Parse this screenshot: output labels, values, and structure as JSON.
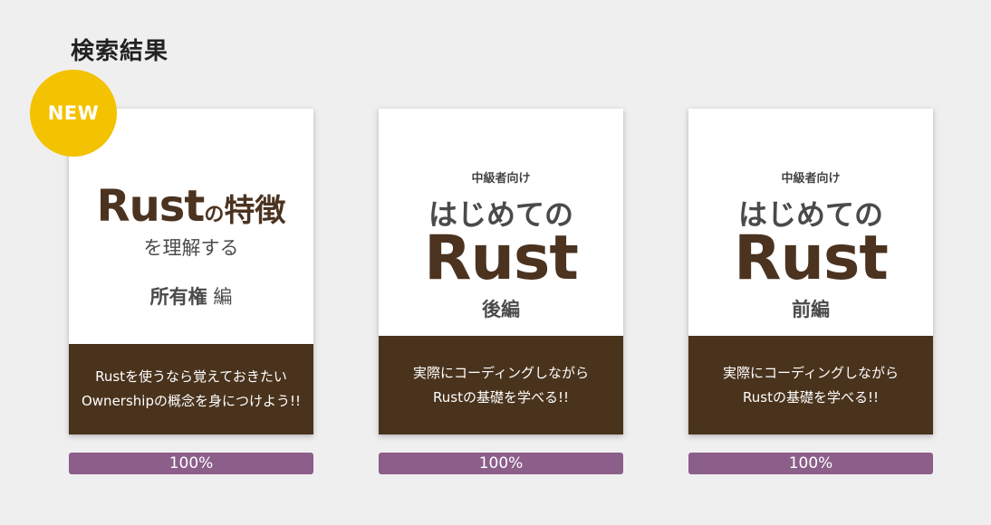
{
  "page": {
    "title": "検索結果"
  },
  "badge": {
    "new_label": "NEW"
  },
  "books": [
    {
      "cover": {
        "title_rust": "Rust",
        "title_no": "の",
        "title_toku": "特徴",
        "subtitle": "を理解する",
        "edition_main": "所有権",
        "edition_suffix": " 編"
      },
      "blurb_line1": "Rustを使うなら覚えておきたい",
      "blurb_line2": "Ownershipの概念を身につけよう!!",
      "progress": "100%"
    },
    {
      "cover": {
        "level": "中級者向け",
        "title_line1": "はじめての",
        "title_line2": "Rust",
        "edition": "後編"
      },
      "blurb_line1": "実際にコーディングしながら",
      "blurb_line2": "Rustの基礎を学べる!!",
      "progress": "100%"
    },
    {
      "cover": {
        "level": "中級者向け",
        "title_line1": "はじめての",
        "title_line2": "Rust",
        "edition": "前編"
      },
      "blurb_line1": "実際にコーディングしながら",
      "blurb_line2": "Rustの基礎を学べる!!",
      "progress": "100%"
    }
  ],
  "colors": {
    "background": "#efefef",
    "cover_brown": "#4a331d",
    "badge_yellow": "#f3c200",
    "progress_purple": "#8c5e8a"
  }
}
